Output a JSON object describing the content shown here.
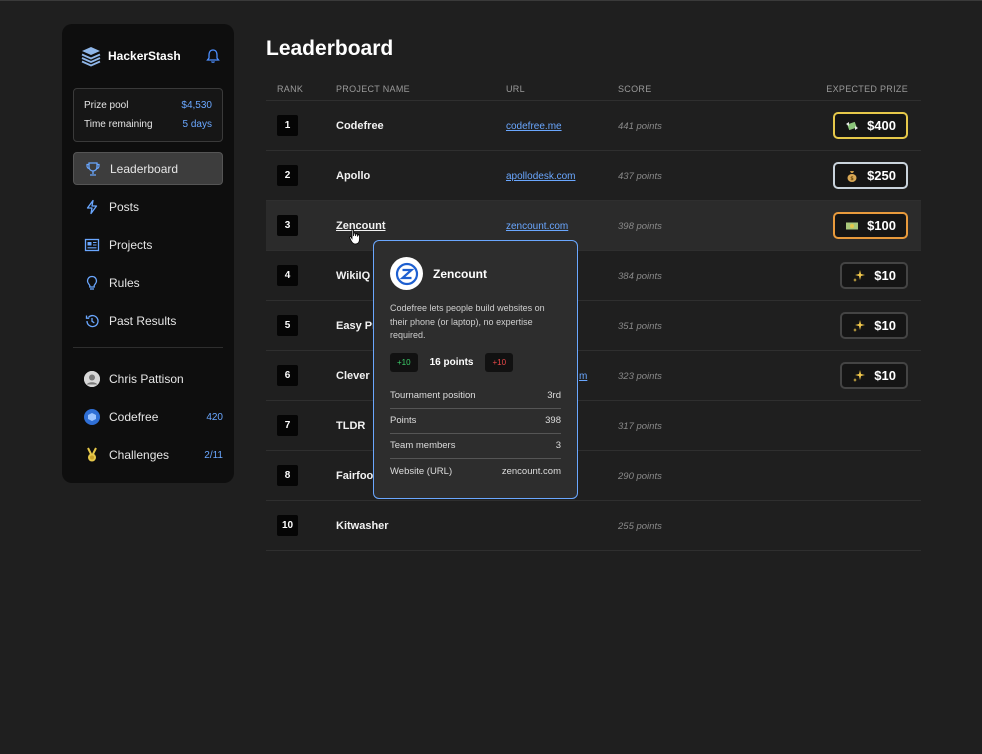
{
  "app": {
    "name": "HackerStash",
    "logo_icon": "stack-logo-icon"
  },
  "prize_box": {
    "pool_label": "Prize pool",
    "pool_value": "$4,530",
    "time_label": "Time remaining",
    "time_value": "5 days"
  },
  "nav": [
    {
      "label": "Leaderboard",
      "icon": "trophy-icon",
      "active": true
    },
    {
      "label": "Posts",
      "icon": "bolt-icon"
    },
    {
      "label": "Projects",
      "icon": "newspaper-icon"
    },
    {
      "label": "Rules",
      "icon": "lightbulb-icon"
    },
    {
      "label": "Past Results",
      "icon": "history-icon"
    }
  ],
  "user": {
    "name": "Chris Pattison",
    "project": "Codefree",
    "project_count": "420",
    "challenges": "Challenges",
    "challenges_count": "2/11"
  },
  "page_title": "Leaderboard",
  "columns": {
    "rank": "RANK",
    "name": "PROJECT NAME",
    "url": "URL",
    "score": "SCORE",
    "prize": "EXPECTED PRIZE"
  },
  "rows": [
    {
      "rank": "1",
      "name": "Codefree",
      "url": "codefree.me",
      "score": "441 points",
      "prize": "$400",
      "tier": "gold"
    },
    {
      "rank": "2",
      "name": "Apollo",
      "url": "apollodesk.com",
      "score": "437 points",
      "prize": "$250",
      "tier": "silver"
    },
    {
      "rank": "3",
      "name": "Zencount",
      "url": "zencount.com",
      "score": "398 points",
      "prize": "$100",
      "tier": "bronze"
    },
    {
      "rank": "4",
      "name": "WikiIQ",
      "url": "",
      "score": "384 points",
      "prize": "$10",
      "tier": "plain"
    },
    {
      "rank": "5",
      "name": "Easy Pr",
      "url": "",
      "score": "351 points",
      "prize": "$10",
      "tier": "plain"
    },
    {
      "rank": "6",
      "name": "Clever",
      "url": "m",
      "score": "323 points",
      "prize": "$10",
      "tier": "plain"
    },
    {
      "rank": "7",
      "name": "TLDR",
      "url": "",
      "score": "317 points",
      "prize": "",
      "tier": "none"
    },
    {
      "rank": "8",
      "name": "Fairfoo",
      "url": "",
      "score": "290 points",
      "prize": "",
      "tier": "none"
    },
    {
      "rank": "10",
      "name": "Kitwasher",
      "url": "",
      "score": "255 points",
      "prize": "",
      "tier": "none"
    }
  ],
  "popover": {
    "title": "Zencount",
    "description": "Codefree lets people build websites on their phone (or laptop), no expertise required.",
    "upvote": "+10",
    "points": "16 points",
    "downvote": "+10",
    "stats": [
      {
        "label": "Tournament position",
        "value": "3rd"
      },
      {
        "label": "Points",
        "value": "398"
      },
      {
        "label": "Team members",
        "value": "3"
      },
      {
        "label": "Website (URL)",
        "value": "zencount.com"
      }
    ]
  },
  "colors": {
    "accent": "#6aa7ff",
    "gold": "#e6c84a",
    "silver": "#c9d3dc",
    "bronze": "#e89a3c"
  }
}
